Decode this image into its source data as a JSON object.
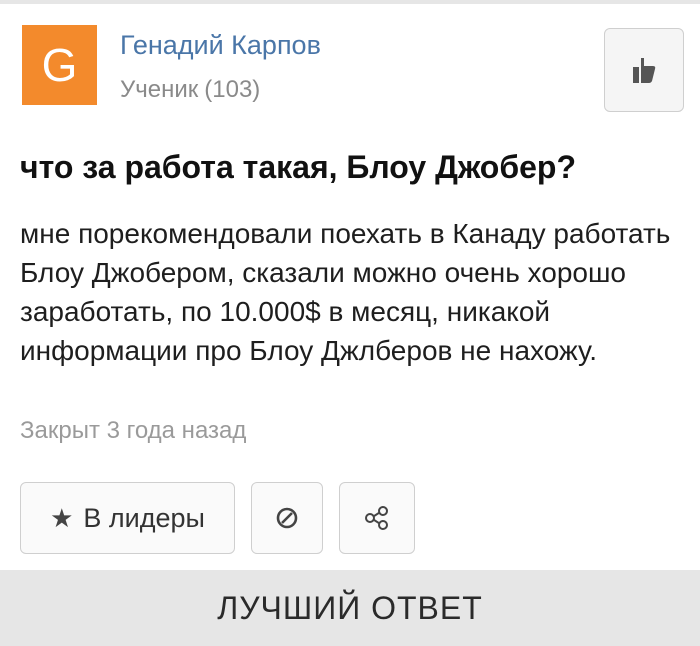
{
  "author": {
    "avatar_letter": "G",
    "avatar_color": "#f38a2c",
    "name": "Генадий Карпов",
    "rank": "Ученик",
    "points": "(103)"
  },
  "actions": {
    "like_icon": "thumbs-up-icon"
  },
  "question": {
    "title": "что за работа такая, Блоу Джобер?",
    "body": "мне порекомендовали поехать в Канаду работать Блоу Джобером, сказали можно очень хорошо заработать, по 10.000$ в месяц, никакой информации про Блоу Джлберов не нахожу.",
    "status": "Закрыт 3 года назад"
  },
  "buttons": {
    "leaders_star": "★",
    "leaders_label": "В лидеры",
    "report_icon": "block-icon",
    "share_icon": "share-icon"
  },
  "section": {
    "best_answer": "ЛУЧШИЙ ОТВЕТ"
  }
}
